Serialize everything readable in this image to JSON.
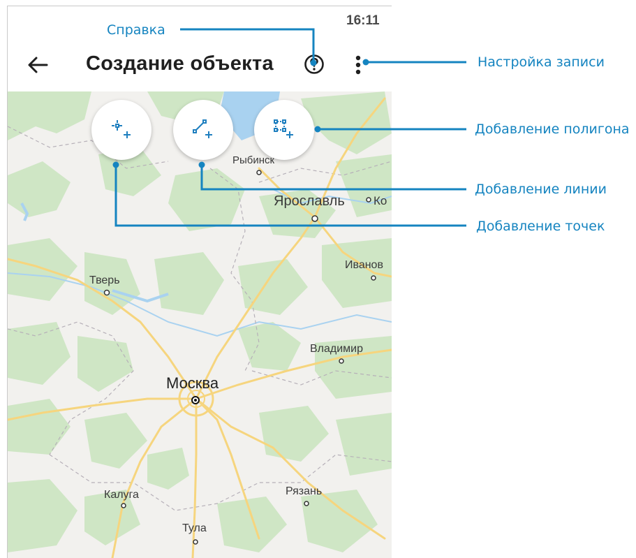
{
  "status_bar": {
    "time": "16:11"
  },
  "app_bar": {
    "title": "Создание объекта",
    "back_icon": "arrow-back-icon",
    "help_icon": "help-circle-icon",
    "more_icon": "more-vert-icon"
  },
  "tools": [
    {
      "id": "add-point",
      "icon": "add-point-icon"
    },
    {
      "id": "add-line",
      "icon": "add-line-icon"
    },
    {
      "id": "add-polygon",
      "icon": "add-polygon-icon"
    }
  ],
  "map": {
    "cities": {
      "moscow": "Москва",
      "yaroslavl": "Ярославль",
      "rybinsk": "Рыбинск",
      "tver": "Тверь",
      "ivanovo": "Иванов",
      "vladimir": "Владимир",
      "kaluga": "Калуга",
      "ryazan": "Рязань",
      "tula": "Тула",
      "kostroma": "Ко"
    }
  },
  "callouts": {
    "help": "Справка",
    "record_settings": "Настройка записи",
    "add_polygon": "Добавление полигона",
    "add_line": "Добавление линии",
    "add_points": "Добавление точек"
  },
  "colors": {
    "accent": "#1584c0",
    "map_green": "#cfe6c5",
    "map_base": "#f2f1ee",
    "water": "#a9d2f0",
    "road": "#f6d57e"
  }
}
